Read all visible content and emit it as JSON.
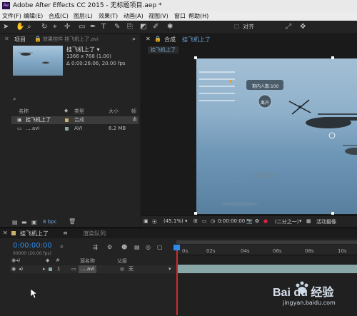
{
  "app": {
    "title": "Adobe After Effects CC 2015 - 无标题项目.aep *",
    "icon_label": "Ae"
  },
  "menu": [
    "文件(F)",
    "编辑(E)",
    "合成(C)",
    "图层(L)",
    "效果(T)",
    "动画(A)",
    "视图(V)",
    "窗口",
    "帮助(H)"
  ],
  "toolbar": {
    "snap_label": "对齐"
  },
  "project_panel": {
    "tab_project": "项目",
    "tab_effects": "效果控件 挂飞机上了.avi",
    "item_name": "挂飞机上了 ▾",
    "item_size": "1366 x 768 (1.00)",
    "item_duration": "Δ 0:00:26:06, 20.00 fps",
    "columns": {
      "name": "名称",
      "type": "类型",
      "size": "大小",
      "rate": "帧"
    },
    "rows": [
      {
        "name": "挂飞机上了",
        "type": "合成",
        "size": ""
      },
      {
        "name": "....avi",
        "type": "AVI",
        "size": "6.2 MB"
      }
    ],
    "bpc": "8 bpc"
  },
  "comp_panel": {
    "tab_label": "合成",
    "comp_name": "挂飞机上了",
    "crumb": "挂飞机上了",
    "zoom": "(45.1%)",
    "timecode": "0:00:00:00",
    "resolution": "(二分之一)",
    "camera": "活动摄像",
    "hud_text": "剩内人数:100",
    "hud_button": "离开"
  },
  "timeline": {
    "tab_comp": "挂飞机上了",
    "tab_render": "渲染队列",
    "timecode": "0:00:00:00",
    "frame_info": "00000 (20.00 fps)",
    "layer_headers": {
      "source": "源名称",
      "parent": "父级"
    },
    "layer": {
      "num": "1",
      "name": "....avi",
      "parent": "无"
    },
    "ruler_marks": [
      "0s",
      "02s",
      "04s",
      "06s",
      "08s",
      "10s"
    ]
  },
  "watermark": {
    "brand": "Bai du 经验",
    "url": "jingyan.baidu.com"
  },
  "colors": {
    "accent_blue": "#2d8ceb",
    "label_yellow": "#c9b36a",
    "label_teal": "#8aa7a8",
    "playhead_red": "#d12a2a"
  }
}
